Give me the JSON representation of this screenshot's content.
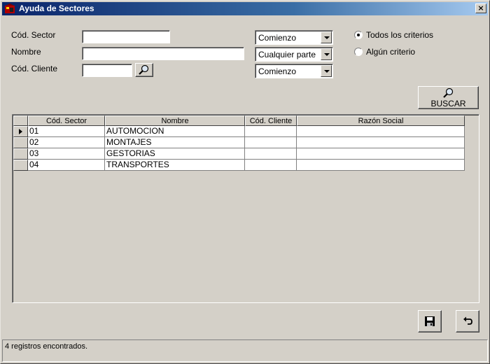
{
  "window": {
    "title": "Ayuda de Sectores",
    "close_label": "×"
  },
  "form": {
    "cod_sector": {
      "label": "Cód. Sector",
      "value": "",
      "match_mode": "Comienzo"
    },
    "nombre": {
      "label": "Nombre",
      "value": "",
      "match_mode": "Cualquier parte"
    },
    "cod_cliente": {
      "label": "Cód. Cliente",
      "value": "",
      "match_mode": "Comienzo"
    },
    "criteria": {
      "all": {
        "label": "Todos los criterios",
        "checked": true
      },
      "any": {
        "label": "Algún criterio",
        "checked": false
      }
    },
    "search_button": {
      "label": "BUSCAR",
      "icon": "magnifier-icon"
    },
    "lookup_icon": "magnifier-icon"
  },
  "grid": {
    "columns": [
      "Cód. Sector",
      "Nombre",
      "Cód. Cliente",
      "Razón Social"
    ],
    "rows": [
      {
        "cod_sector": "01",
        "nombre": "AUTOMOCION",
        "cod_cliente": "",
        "razon_social": ""
      },
      {
        "cod_sector": "02",
        "nombre": "MONTAJES",
        "cod_cliente": "",
        "razon_social": ""
      },
      {
        "cod_sector": "03",
        "nombre": "GESTORIAS",
        "cod_cliente": "",
        "razon_social": ""
      },
      {
        "cod_sector": "04",
        "nombre": "TRANSPORTES",
        "cod_cliente": "",
        "razon_social": ""
      }
    ]
  },
  "actions": {
    "save_icon": "floppy-disk-icon",
    "undo_icon": "undo-arrow-icon"
  },
  "status": {
    "text": "4 registros encontrados."
  },
  "colors": {
    "title_start": "#0a246a",
    "title_end": "#a6caf0",
    "face": "#d4d0c8"
  }
}
